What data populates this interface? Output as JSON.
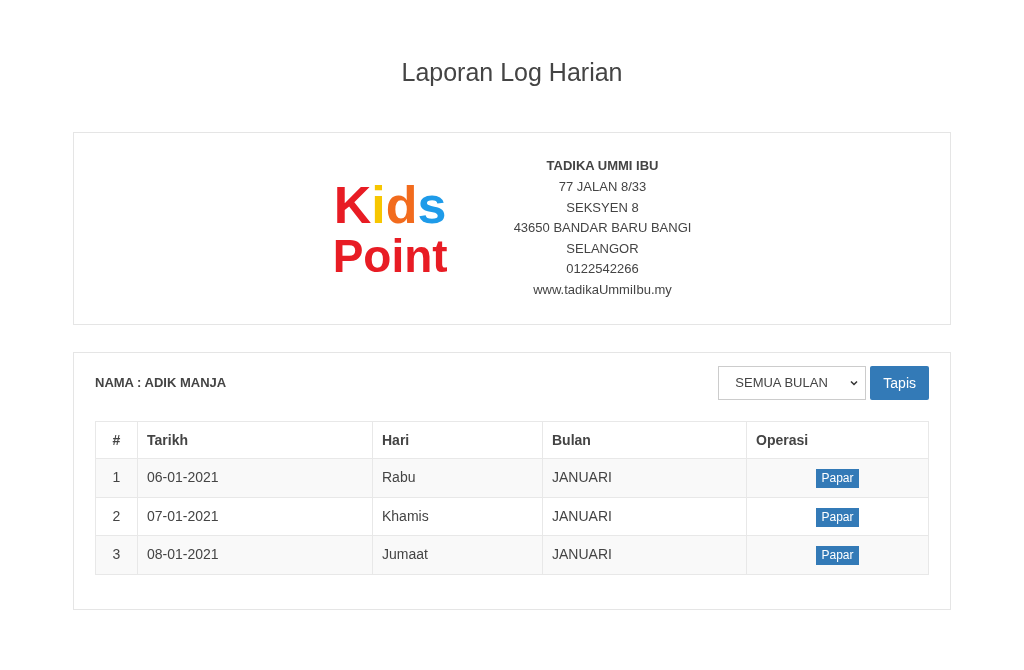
{
  "page_title": "Laporan Log Harian",
  "header": {
    "logo": {
      "line_1": "Kids",
      "line_2": "Point"
    },
    "address": [
      {
        "text": "TADIKA UMMI IBU",
        "bold": true
      },
      {
        "text": "77 JALAN 8/33",
        "bold": false
      },
      {
        "text": "SEKSYEN 8",
        "bold": false
      },
      {
        "text": "43650 BANDAR BARU BANGI",
        "bold": false
      },
      {
        "text": "SELANGOR",
        "bold": false
      },
      {
        "text": "0122542266",
        "bold": false
      },
      {
        "text": "www.tadikaUmmiIbu.my",
        "bold": false
      }
    ]
  },
  "filter": {
    "name_label": "NAMA : ADIK MANJA",
    "month_select": "SEMUA BULAN",
    "button": "Tapis"
  },
  "table": {
    "columns": [
      "#",
      "Tarikh",
      "Hari",
      "Bulan",
      "Operasi"
    ],
    "rows": [
      {
        "cells": [
          "1",
          "06-01-2021",
          "Rabu",
          "JANUARI"
        ],
        "action": "Papar"
      },
      {
        "cells": [
          "2",
          "07-01-2021",
          "Khamis",
          "JANUARI"
        ],
        "action": "Papar"
      },
      {
        "cells": [
          "3",
          "08-01-2021",
          "Jumaat",
          "JANUARI"
        ],
        "action": "Papar"
      }
    ]
  }
}
